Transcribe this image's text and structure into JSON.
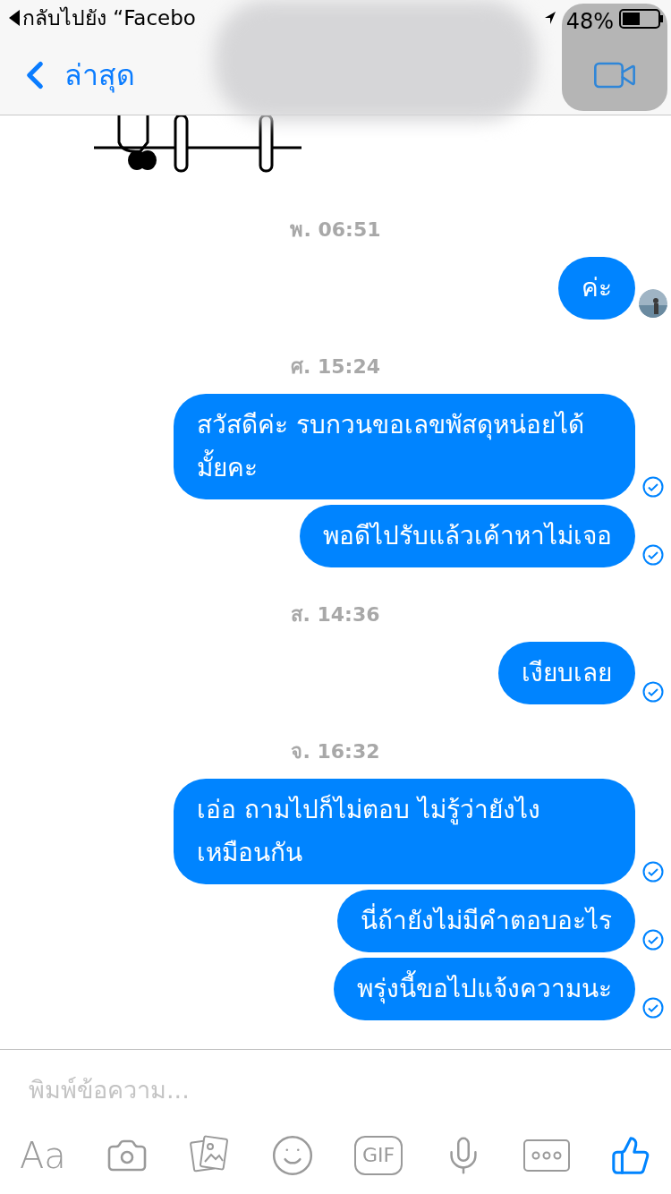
{
  "status_bar": {
    "back_app": "กลับไปยัง “Facebo",
    "battery": "48%"
  },
  "nav": {
    "back": "ล่าสุด"
  },
  "composer": {
    "placeholder": "พิมพ์ข้อความ...",
    "toolbar": [
      {
        "kind": "text",
        "label": "Aa"
      },
      {
        "kind": "camera"
      },
      {
        "kind": "photos"
      },
      {
        "kind": "emoji"
      },
      {
        "kind": "gif",
        "label": "GIF"
      },
      {
        "kind": "mic"
      },
      {
        "kind": "more"
      },
      {
        "kind": "like"
      }
    ]
  },
  "conversation": [
    {
      "time": "พ. 06:51",
      "messages": [
        {
          "text": "ค่ะ",
          "kind": "avatar"
        }
      ]
    },
    {
      "time": "ศ. 15:24",
      "messages": [
        {
          "text": "สวัสดีค่ะ รบกวนขอเลขพัสดุหน่อยได้มั้ยคะ",
          "kind": "sent"
        },
        {
          "text": "พอดีไปรับแล้วเค้าหาไม่เจอ",
          "kind": "sent"
        }
      ]
    },
    {
      "time": "ส. 14:36",
      "messages": [
        {
          "text": "เงียบเลย",
          "kind": "sent"
        }
      ]
    },
    {
      "time": "จ. 16:32",
      "messages": [
        {
          "text": "เอ่อ ถามไปก็ไม่ตอบ ไม่รู้ว่ายังไงเหมือนกัน",
          "kind": "sent"
        },
        {
          "text": "นี่ถ้ายังไม่มีคำตอบอะไร",
          "kind": "sent"
        },
        {
          "text": "พรุ่งนี้ขอไปแจ้งความนะ",
          "kind": "sent"
        }
      ]
    }
  ]
}
